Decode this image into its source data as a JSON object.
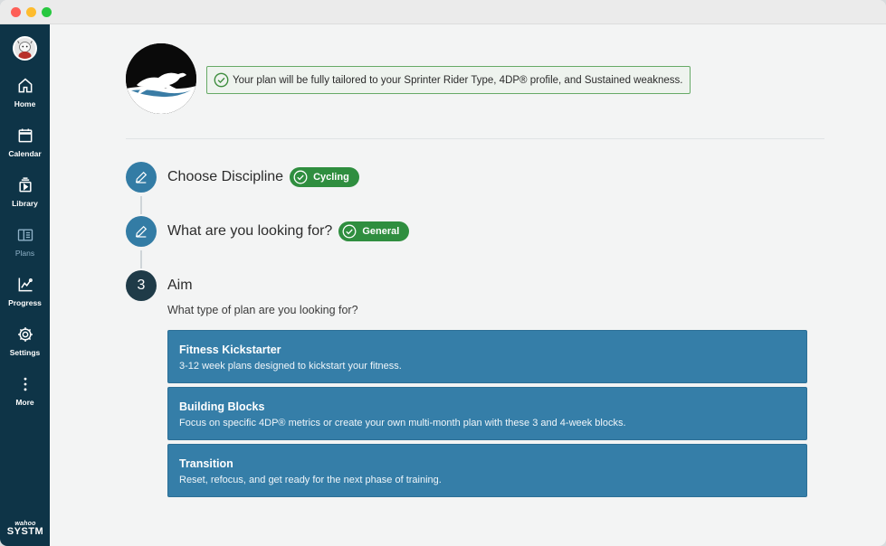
{
  "colors": {
    "sidebar": "#0e3447",
    "accent": "#337ca5",
    "success": "#2f8e3f",
    "step_dark": "#1f3b48"
  },
  "sidebar": {
    "items": [
      {
        "label": "Home",
        "icon": "home-icon",
        "active": false
      },
      {
        "label": "Calendar",
        "icon": "calendar-icon",
        "active": false
      },
      {
        "label": "Library",
        "icon": "library-icon",
        "active": false
      },
      {
        "label": "Plans",
        "icon": "plans-icon",
        "active": true
      },
      {
        "label": "Progress",
        "icon": "progress-chart-icon",
        "active": false
      },
      {
        "label": "Settings",
        "icon": "gear-icon",
        "active": false
      },
      {
        "label": "More",
        "icon": "more-vertical-icon",
        "active": false
      }
    ],
    "brand_small": "wahoo",
    "brand_big": "SYSTM"
  },
  "banner": {
    "text": "Your plan will be fully tailored to your Sprinter Rider Type, 4DP® profile, and Sustained weakness."
  },
  "steps": [
    {
      "title": "Choose Discipline",
      "selected": "Cycling",
      "icon": "pencil-icon"
    },
    {
      "title": "What are you looking for?",
      "selected": "General",
      "icon": "pencil-icon"
    },
    {
      "number": "3",
      "title": "Aim",
      "question": "What type of plan are you looking for?"
    }
  ],
  "options": [
    {
      "title": "Fitness Kickstarter",
      "description": "3-12 week plans designed to kickstart your fitness."
    },
    {
      "title": "Building Blocks",
      "description": "Focus on specific 4DP® metrics or create your own multi-month plan with these 3 and 4-week blocks."
    },
    {
      "title": "Transition",
      "description": "Reset, refocus, and get ready for the next phase of training."
    }
  ]
}
